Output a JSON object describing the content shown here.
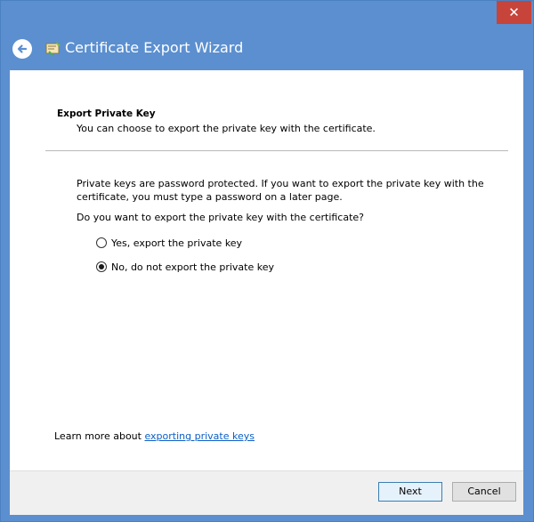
{
  "window": {
    "title": "Certificate Export Wizard",
    "close_glyph": "✕",
    "icons": {
      "back": "back-arrow-icon",
      "app": "certificate-wizard-icon",
      "close": "close-icon"
    }
  },
  "header": {
    "title": "Export Private Key",
    "description": "You can choose to export the private key with the certificate."
  },
  "body": {
    "paragraph": "Private keys are password protected. If you want to export the private key with the certificate, you must type a password on a later page.",
    "question": "Do you want to export the private key with the certificate?",
    "options": [
      {
        "label": "Yes, export the private key",
        "selected": false
      },
      {
        "label": "No, do not export the private key",
        "selected": true
      }
    ]
  },
  "learn_more": {
    "prefix": "Learn more about",
    "link_text": "exporting private keys"
  },
  "buttons": {
    "next": "Next",
    "cancel": "Cancel"
  },
  "colors": {
    "titlebar": "#5b8fd0",
    "close_button": "#c7443b",
    "link": "#0b5fc8"
  }
}
